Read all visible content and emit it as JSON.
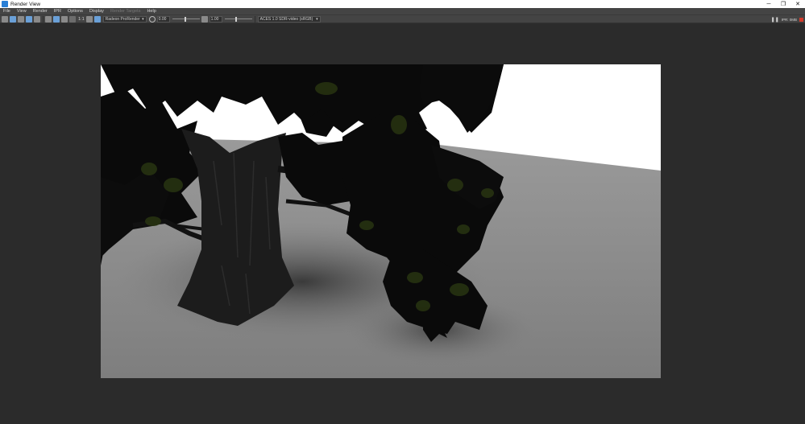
{
  "window": {
    "title": "Render View",
    "controls": {
      "minimize": "─",
      "maximize": "❐",
      "close": "✕"
    }
  },
  "menu": {
    "items": [
      "File",
      "View",
      "Render",
      "IPR",
      "Options",
      "Display",
      "Render Targets",
      "Help"
    ]
  },
  "toolbar": {
    "ratio_label": "1:1",
    "renderer": "Radeon ProRender",
    "exposure_value": "0.00",
    "gamma_value": "1.00",
    "color_space": "ACES 1.0 SDR-video (sRGB)",
    "pause_glyph": "❚❚",
    "ipr_label": "IPR: 0MB"
  },
  "colors": {
    "window_bg": "#2b2b2b",
    "menubar_bg": "#444444",
    "sky": "#ffffff",
    "ground": "#8c8c8c",
    "bark": "#1c1c1c",
    "leaves": "#0a0a0a",
    "leaf_tint": "#2c3a12",
    "stop": "#d43a2a"
  },
  "icons": [
    "app-icon",
    "open-icon",
    "render-icon",
    "ipr-render-icon",
    "snapshot-icon",
    "region-icon",
    "keep-image-icon",
    "remove-image-icon",
    "fit-icon",
    "real-size-icon",
    "rgb-channels-icon",
    "alpha-icon",
    "gear-icon",
    "exposure-icon",
    "pause-icon",
    "stop-icon"
  ]
}
